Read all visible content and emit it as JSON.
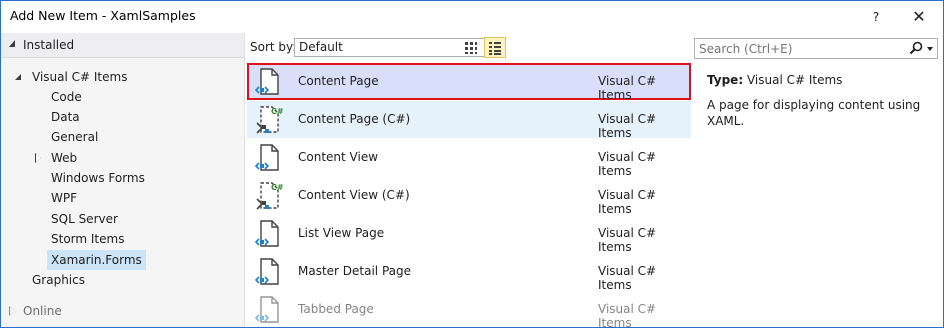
{
  "window": {
    "title": "Add New Item - XamlSamples",
    "help_label": "?",
    "close_label": "✕"
  },
  "tree": {
    "installed_label": "Installed",
    "visual_csharp_label": "Visual C# Items",
    "children": [
      "Code",
      "Data",
      "General",
      "Web",
      "Windows Forms",
      "WPF",
      "SQL Server",
      "Storm Items",
      "Xamarin.Forms"
    ],
    "graphics_label": "Graphics",
    "online_label": "Online",
    "selected": "Xamarin.Forms"
  },
  "toolbar": {
    "sortby_label": "Sort by:",
    "sort_value": "Default"
  },
  "search": {
    "placeholder": "Search (Ctrl+E)"
  },
  "items": [
    {
      "name": "Content Page",
      "category": "Visual C# Items",
      "icon": "xaml-page-icon"
    },
    {
      "name": "Content Page (C#)",
      "category": "Visual C# Items",
      "icon": "csharp-page-icon"
    },
    {
      "name": "Content View",
      "category": "Visual C# Items",
      "icon": "xaml-page-icon"
    },
    {
      "name": "Content View (C#)",
      "category": "Visual C# Items",
      "icon": "csharp-page-icon"
    },
    {
      "name": "List View Page",
      "category": "Visual C# Items",
      "icon": "xaml-page-icon"
    },
    {
      "name": "Master Detail Page",
      "category": "Visual C# Items",
      "icon": "xaml-page-icon"
    },
    {
      "name": "Tabbed Page",
      "category": "Visual C# Items",
      "icon": "xaml-page-icon"
    }
  ],
  "description": {
    "type_label": "Type:",
    "type_value": "Visual C# Items",
    "text": "A page for displaying content using XAML."
  },
  "colors": {
    "accent": "#2b6fce",
    "selection_border": "#e0101f",
    "selection_fill": "#d9dffa",
    "tree_selection": "#cce4f7"
  }
}
